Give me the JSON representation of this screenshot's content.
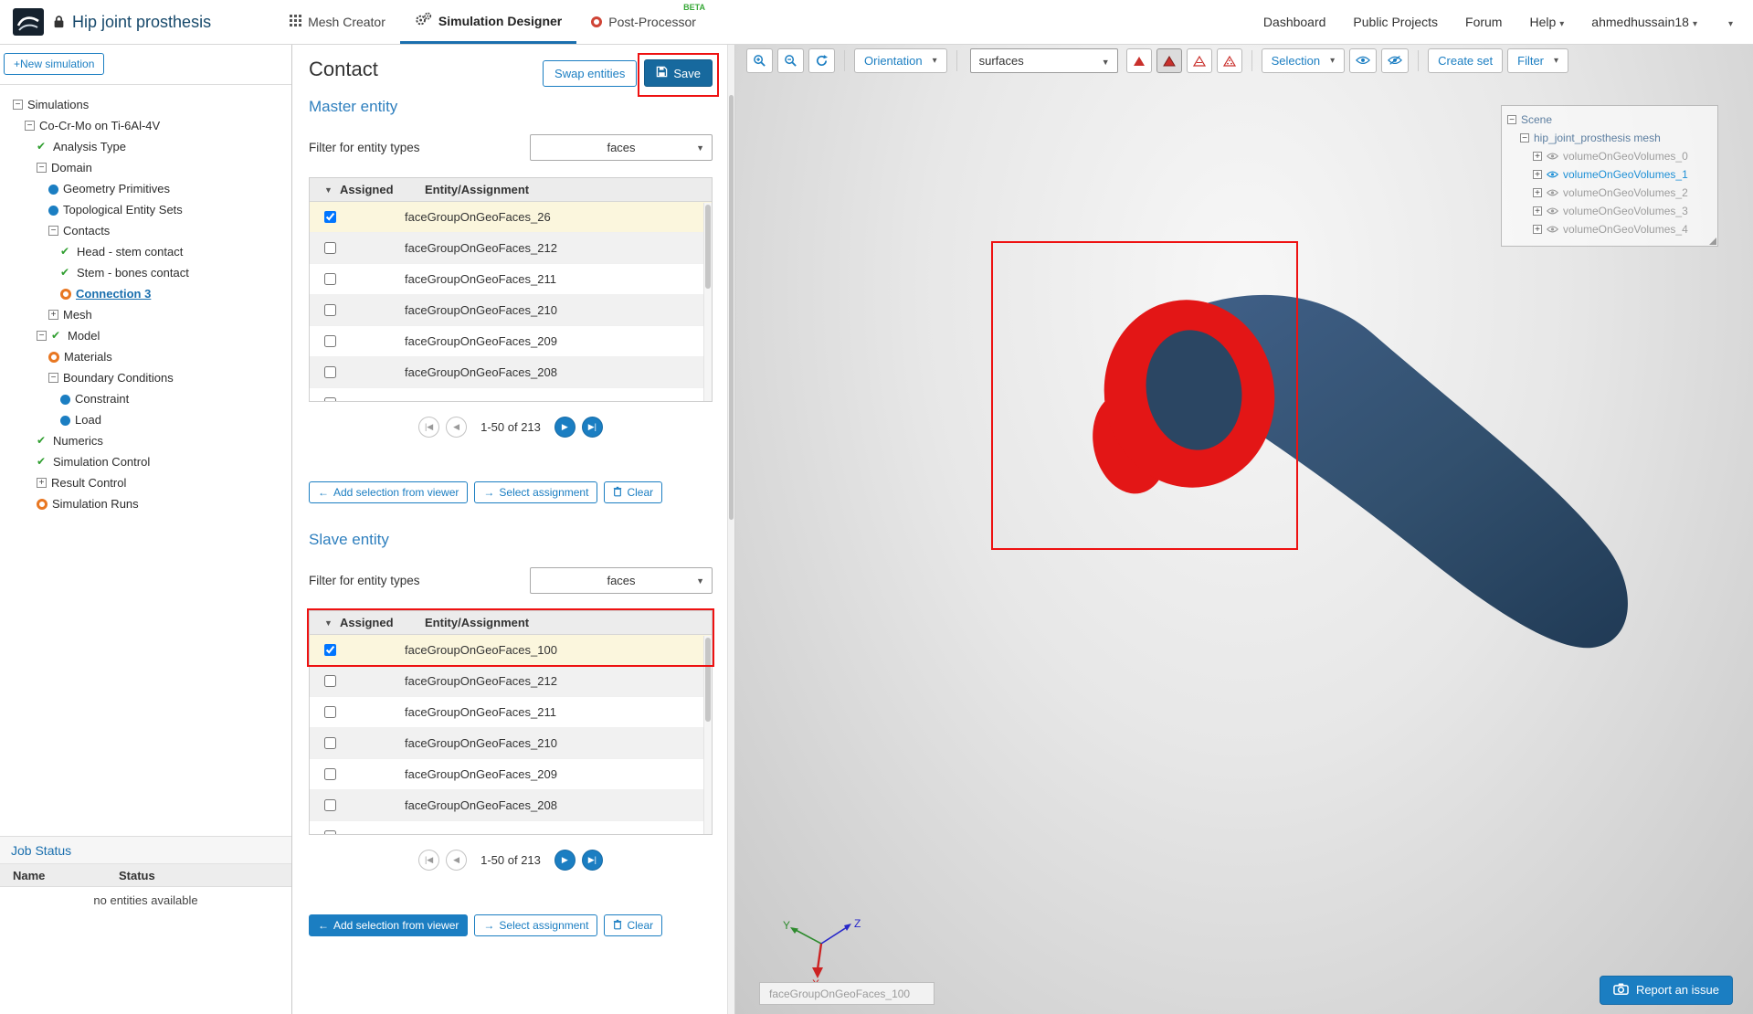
{
  "colors": {
    "accent": "#1b7ec2",
    "accent_dark": "#17699e",
    "heading_blue": "#2e7fbe",
    "annotation_red": "#ee1111",
    "model_navy": "#32506e",
    "selection_red": "#e31616",
    "check_green": "#2f9e2f",
    "pending_orange": "#e87722",
    "scene_highlight": "#1e90d6"
  },
  "icons": {
    "caret_down": "▾",
    "select_caret": "▼",
    "sort_desc": "▼",
    "plus": "+",
    "first_page": "|◀",
    "prev_page": "◀",
    "next_page": "▶",
    "last_page": "▶|",
    "arrow_left": "←",
    "arrow_right": "→"
  },
  "navbar": {
    "title": "Hip joint prosthesis",
    "tabs": [
      {
        "label": "Mesh Creator",
        "badge": ""
      },
      {
        "label": "Simulation Designer",
        "badge": ""
      },
      {
        "label": "Post-Processor",
        "badge": "BETA"
      }
    ],
    "links": [
      "Dashboard",
      "Public Projects",
      "Forum"
    ],
    "help_label": "Help",
    "user": "ahmedhussain18"
  },
  "sidebar": {
    "new_simulation_label": "New simulation",
    "tree": [
      {
        "label": "Simulations",
        "depth": 0,
        "exp": "minus",
        "st": "",
        "sel": false
      },
      {
        "label": "Co-Cr-Mo on Ti-6Al-4V",
        "depth": 1,
        "exp": "minus",
        "st": "",
        "sel": false
      },
      {
        "label": "Analysis Type",
        "depth": 2,
        "exp": "",
        "st": "check",
        "sel": false
      },
      {
        "label": "Domain",
        "depth": 2,
        "exp": "minus",
        "st": "",
        "sel": false
      },
      {
        "label": "Geometry Primitives",
        "depth": 3,
        "exp": "",
        "st": "dot",
        "sel": false
      },
      {
        "label": "Topological Entity Sets",
        "depth": 3,
        "exp": "",
        "st": "dot",
        "sel": false
      },
      {
        "label": "Contacts",
        "depth": 3,
        "exp": "minus",
        "st": "",
        "sel": false
      },
      {
        "label": "Head - stem contact",
        "depth": 4,
        "exp": "",
        "st": "check",
        "sel": false
      },
      {
        "label": "Stem - bones contact",
        "depth": 4,
        "exp": "",
        "st": "check",
        "sel": false
      },
      {
        "label": "Connection 3",
        "depth": 4,
        "exp": "",
        "st": "circle",
        "sel": true
      },
      {
        "label": "Mesh",
        "depth": 3,
        "exp": "plus",
        "st": "",
        "sel": false
      },
      {
        "label": "Model",
        "depth": 2,
        "exp": "minus",
        "st": "check",
        "sel": false
      },
      {
        "label": "Materials",
        "depth": 3,
        "exp": "",
        "st": "circle",
        "sel": false
      },
      {
        "label": "Boundary Conditions",
        "depth": 3,
        "exp": "minus",
        "st": "",
        "sel": false
      },
      {
        "label": "Constraint",
        "depth": 4,
        "exp": "",
        "st": "dot",
        "sel": false
      },
      {
        "label": "Load",
        "depth": 4,
        "exp": "",
        "st": "dot",
        "sel": false
      },
      {
        "label": "Numerics",
        "depth": 2,
        "exp": "",
        "st": "check",
        "sel": false
      },
      {
        "label": "Simulation Control",
        "depth": 2,
        "exp": "",
        "st": "check",
        "sel": false
      },
      {
        "label": "Result Control",
        "depth": 2,
        "exp": "plus",
        "st": "",
        "sel": false
      },
      {
        "label": "Simulation Runs",
        "depth": 2,
        "exp": "",
        "st": "circle",
        "sel": false
      }
    ],
    "job_status": {
      "title": "Job Status",
      "columns": [
        "Name",
        "Status"
      ],
      "empty": "no entities available"
    }
  },
  "panel": {
    "title": "Contact",
    "swap_label": "Swap entities",
    "save_label": "Save",
    "filter_label": "Filter for entity types",
    "columns": [
      "Assigned",
      "Entity/Assignment"
    ],
    "pagination": "1-50 of 213",
    "actions": {
      "add": "Add selection from viewer",
      "select": "Select assignment",
      "clear": "Clear"
    },
    "master": {
      "heading": "Master entity",
      "filter_value": "faces",
      "rows": [
        {
          "label": "faceGroupOnGeoFaces_26",
          "checked": true
        },
        {
          "label": "faceGroupOnGeoFaces_212",
          "checked": false
        },
        {
          "label": "faceGroupOnGeoFaces_211",
          "checked": false
        },
        {
          "label": "faceGroupOnGeoFaces_210",
          "checked": false
        },
        {
          "label": "faceGroupOnGeoFaces_209",
          "checked": false
        },
        {
          "label": "faceGroupOnGeoFaces_208",
          "checked": false
        },
        {
          "label": "",
          "checked": false
        }
      ]
    },
    "slave": {
      "heading": "Slave entity",
      "filter_value": "faces",
      "rows": [
        {
          "label": "faceGroupOnGeoFaces_100",
          "checked": true
        },
        {
          "label": "faceGroupOnGeoFaces_212",
          "checked": false
        },
        {
          "label": "faceGroupOnGeoFaces_211",
          "checked": false
        },
        {
          "label": "faceGroupOnGeoFaces_210",
          "checked": false
        },
        {
          "label": "faceGroupOnGeoFaces_209",
          "checked": false
        },
        {
          "label": "faceGroupOnGeoFaces_208",
          "checked": false
        },
        {
          "label": "",
          "checked": false
        }
      ]
    }
  },
  "viewer": {
    "toolbar": {
      "orientation": "Orientation",
      "mesh_select": "surfaces",
      "selection": "Selection",
      "create_set": "Create set",
      "filter": "Filter"
    },
    "scene": {
      "root": "Scene",
      "mesh": "hip_joint_prosthesis mesh",
      "volumes": [
        {
          "label": "volumeOnGeoVolumes_0",
          "hl": false
        },
        {
          "label": "volumeOnGeoVolumes_1",
          "hl": true
        },
        {
          "label": "volumeOnGeoVolumes_2",
          "hl": false
        },
        {
          "label": "volumeOnGeoVolumes_3",
          "hl": false
        },
        {
          "label": "volumeOnGeoVolumes_4",
          "hl": false
        }
      ]
    },
    "axis": {
      "y": "Y",
      "z": "Z",
      "x": "X"
    },
    "tooltip": "faceGroupOnGeoFaces_100",
    "report": "Report an issue"
  }
}
